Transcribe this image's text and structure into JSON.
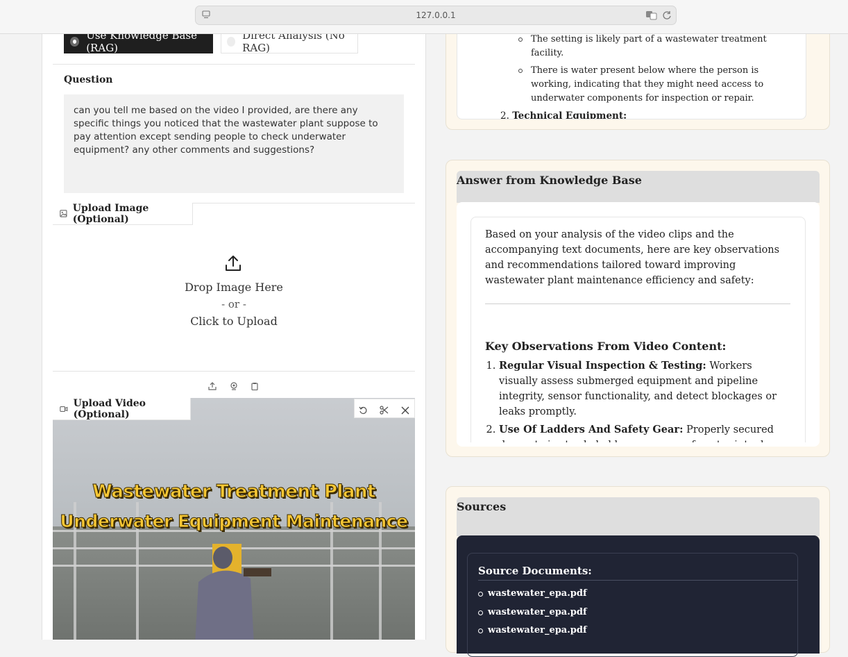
{
  "browser": {
    "url": "127.0.0.1"
  },
  "mode": {
    "options": [
      {
        "label": "Use Knowledge Base (RAG)",
        "selected": true
      },
      {
        "label": "Direct Analysis (No RAG)",
        "selected": false
      }
    ]
  },
  "question": {
    "label": "Question",
    "value": "can you tell me based on the video I provided, are there any specific things you noticed that the wastewater plant suppose to pay attention except sending people to check underwater equipment? any other comments and suggestions?"
  },
  "image_upload": {
    "label": "Upload Image (Optional)",
    "drop_text": "Drop Image Here",
    "or_text": "- or -",
    "click_text": "Click to Upload"
  },
  "video_upload": {
    "label": "Upload Video (Optional)",
    "caption_line1": "Wastewater Treatment Plant",
    "caption_line2": "Underwater Equipment Maintenance"
  },
  "analysis_panel": {
    "bullet1": "The setting is likely part of a wastewater treatment facility.",
    "bullet2": "There is water present below where the person is working, indicating that they might need access to underwater components for inspection or repair.",
    "item2_num": "2.",
    "item2_title": "Technical Equipment",
    "item2_colon": ":"
  },
  "answer_panel": {
    "title": "Answer from Knowledge Base",
    "intro": "Based on your analysis of the video clips and the accompanying text documents, here are key observations and recommendations tailored toward improving wastewater plant maintenance efficiency and safety:",
    "heading": "Key Observations From Video Content:",
    "items": [
      {
        "title": "Regular Visual Inspection & Testing:",
        "text": " Workers visually assess submerged equipment and pipeline integrity, sensor functionality, and detect blockages or leaks promptly."
      },
      {
        "title": "Use Of Ladders And Safety Gear:",
        "text": " Properly secured descent via sturdy ladders ensures safe entry into deep sections. Divers"
      }
    ]
  },
  "sources_panel": {
    "title": "Sources",
    "heading": "Source Documents:",
    "documents": [
      "wastewater_epa.pdf",
      "wastewater_epa.pdf",
      "wastewater_epa.pdf"
    ]
  }
}
